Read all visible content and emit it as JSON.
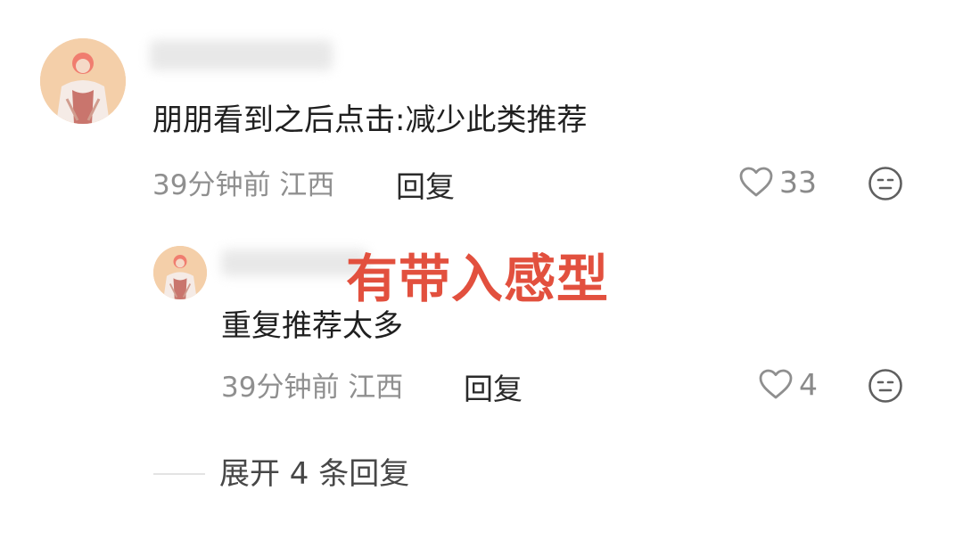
{
  "comment": {
    "text": "朋朋看到之后点击:减少此类推荐",
    "time_location": "39分钟前 江西",
    "reply_label": "回复",
    "like_count": "33",
    "icons": {
      "like": "heart-outline-icon",
      "emoji": "neutral-face-icon"
    }
  },
  "reply": {
    "text": "重复推荐太多",
    "time_location": "39分钟前 江西",
    "reply_label": "回复",
    "like_count": "4",
    "icons": {
      "like": "heart-outline-icon",
      "emoji": "neutral-face-icon"
    }
  },
  "overlay": {
    "caption": "有带入感型",
    "color": "#e2503e"
  },
  "expand": {
    "label": "展开 4 条回复"
  },
  "colors": {
    "primary_text": "#1f1f1f",
    "meta_text": "#8f8f8f",
    "like_count": "#8a8a8a",
    "expand_text": "#474747"
  }
}
